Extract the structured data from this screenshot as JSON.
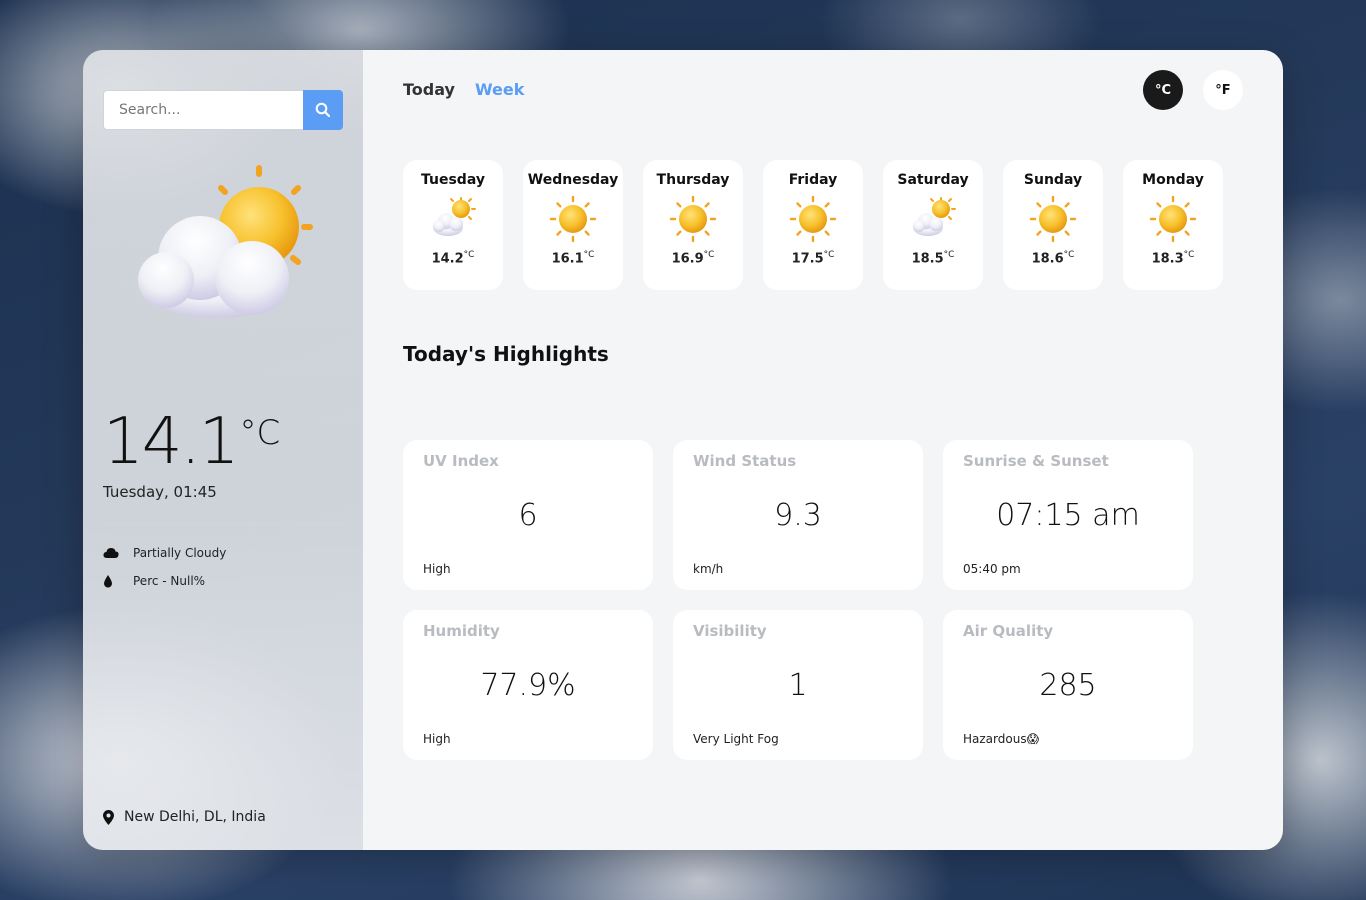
{
  "search": {
    "placeholder": "Search..."
  },
  "current": {
    "temp": "14.1",
    "unit": "°C",
    "datetime": "Tuesday, 01:45",
    "condition": "Partially Cloudy",
    "precip": "Perc - Null%",
    "location": "New Delhi, DL, India",
    "icon": "partly-cloudy-icon"
  },
  "tabs": {
    "today": "Today",
    "week": "Week"
  },
  "units": {
    "celsius": "°C",
    "fahrenheit": "°F"
  },
  "week": [
    {
      "day": "Tuesday",
      "temp": "14.2",
      "unit": "°C",
      "icon": "partly-cloudy-icon"
    },
    {
      "day": "Wednesday",
      "temp": "16.1",
      "unit": "°C",
      "icon": "sun-icon"
    },
    {
      "day": "Thursday",
      "temp": "16.9",
      "unit": "°C",
      "icon": "sun-icon"
    },
    {
      "day": "Friday",
      "temp": "17.5",
      "unit": "°C",
      "icon": "sun-icon"
    },
    {
      "day": "Saturday",
      "temp": "18.5",
      "unit": "°C",
      "icon": "partly-cloudy-icon"
    },
    {
      "day": "Sunday",
      "temp": "18.6",
      "unit": "°C",
      "icon": "sun-icon"
    },
    {
      "day": "Monday",
      "temp": "18.3",
      "unit": "°C",
      "icon": "sun-icon"
    }
  ],
  "highlights": {
    "title": "Today's Highlights",
    "cards": [
      {
        "label": "UV Index",
        "value": "6",
        "sub": "High"
      },
      {
        "label": "Wind Status",
        "value": "9.3",
        "sub": "km/h"
      },
      {
        "label": "Sunrise & Sunset",
        "value": "07:15 am",
        "sub": "05:40 pm"
      },
      {
        "label": "Humidity",
        "value": "77.9%",
        "sub": "High"
      },
      {
        "label": "Visibility",
        "value": "1",
        "sub": "Very Light Fog"
      },
      {
        "label": "Air Quality",
        "value": "285",
        "sub": "Hazardous😱"
      }
    ]
  },
  "colors": {
    "accent": "#5b9cf4",
    "dark": "#1a1a1a",
    "panel": "#f4f5f7"
  }
}
